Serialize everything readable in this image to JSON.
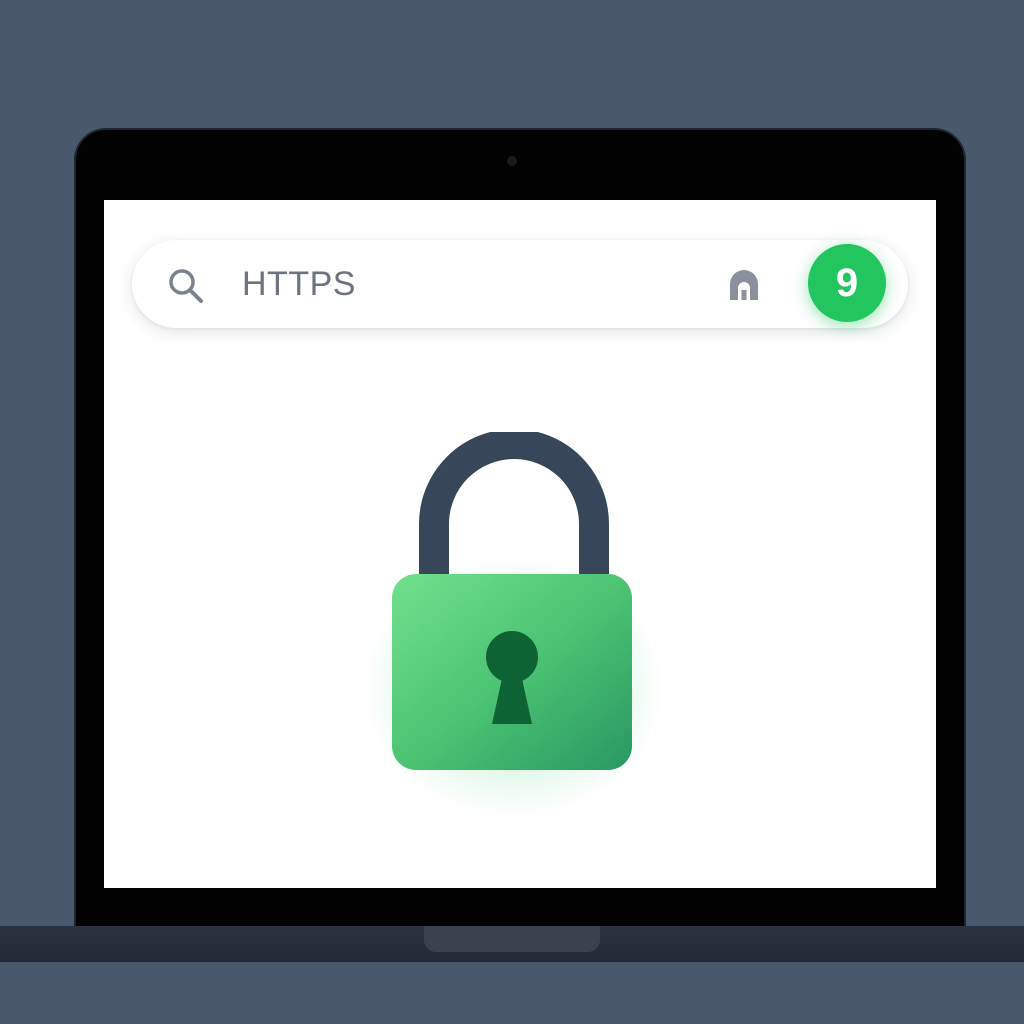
{
  "address_bar": {
    "url_text": "HTTPS",
    "search_icon": "search-icon",
    "site_info_icon": "site-info-icon",
    "profile_badge": "9"
  },
  "hero": {
    "icon": "padlock-icon"
  },
  "colors": {
    "background": "#4a586b",
    "bezel": "#020202",
    "screen": "#ffffff",
    "accent_green": "#22c55e",
    "lock_shackle": "#38465a",
    "keyhole": "#0d6334",
    "url_text": "#6b7380"
  }
}
